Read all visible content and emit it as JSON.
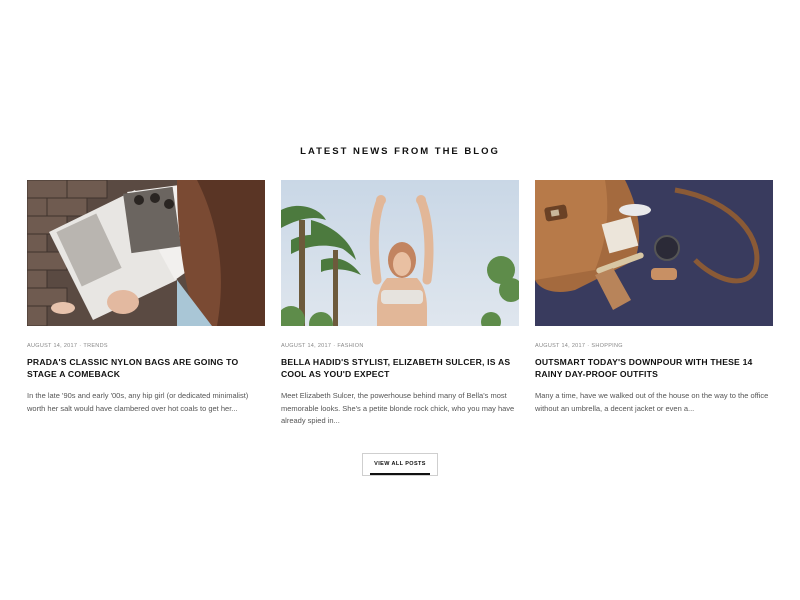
{
  "section": {
    "title": "LATEST NEWS FROM THE BLOG"
  },
  "posts": [
    {
      "date": "AUGUST 14, 2017",
      "separator": "·",
      "category": "TRENDS",
      "title": "PRADA'S CLASSIC NYLON BAGS ARE GOING TO STAGE A COMEBACK",
      "excerpt": "In the late '90s and early '00s, any hip girl (or dedicated minimalist) worth her salt would have clambered over hot coals to get her..."
    },
    {
      "date": "AUGUST 14, 2017",
      "separator": "·",
      "category": "FASHION",
      "title": "BELLA HADID'S STYLIST, ELIZABETH SULCER, IS AS COOL AS YOU'D EXPECT",
      "excerpt": "Meet Elizabeth Sulcer, the powerhouse behind many of Bella's most memorable looks. She's a petite blonde rock chick, who you may have already spied in..."
    },
    {
      "date": "AUGUST 14, 2017",
      "separator": "·",
      "category": "SHOPPING",
      "title": "OUTSMART TODAY'S DOWNPOUR WITH THESE 14 RAINY DAY-PROOF OUTFITS",
      "excerpt": "Many a time, have we walked out of the house on the way to the office without an umbrella, a decent jacket or even a..."
    }
  ],
  "view_all": {
    "label": "VIEW ALL POSTS"
  }
}
